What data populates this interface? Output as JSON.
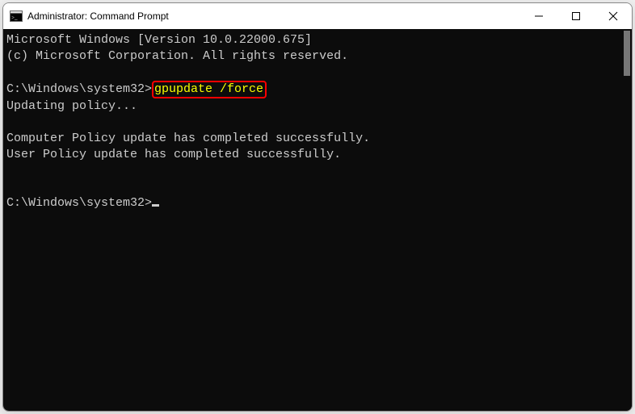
{
  "window": {
    "title": "Administrator: Command Prompt",
    "icon_name": "cmd-icon"
  },
  "terminal": {
    "line_version": "Microsoft Windows [Version 10.0.22000.675]",
    "line_copyright": "(c) Microsoft Corporation. All rights reserved.",
    "prompt_path": "C:\\Windows\\system32>",
    "command": "gpupdate /force",
    "line_updating": "Updating policy...",
    "line_computer_policy": "Computer Policy update has completed successfully.",
    "line_user_policy": "User Policy update has completed successfully."
  }
}
